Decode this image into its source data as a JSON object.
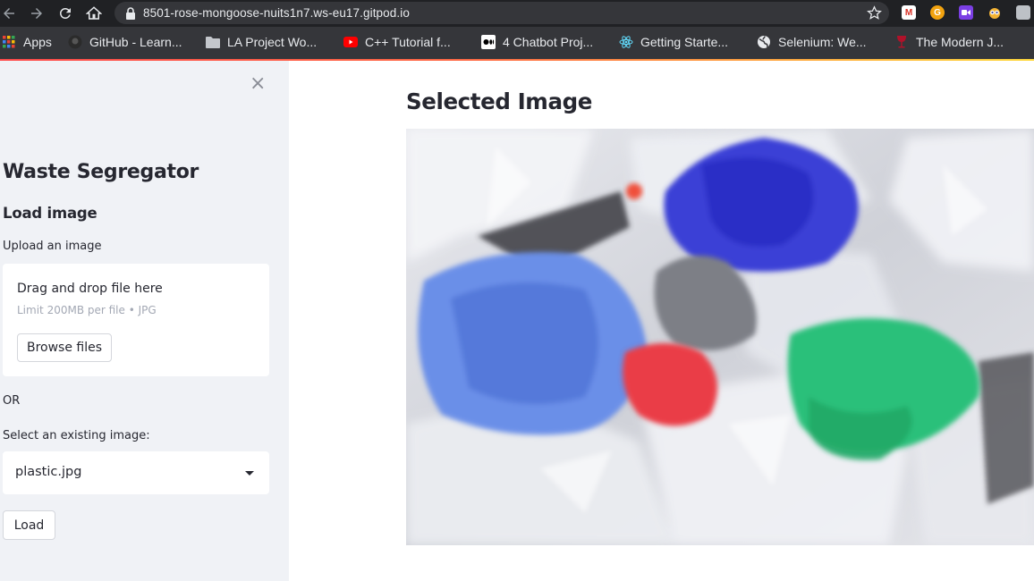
{
  "browser": {
    "url": "8501-rose-mongoose-nuits1n7.ws-eu17.gitpod.io",
    "bookmarks": [
      {
        "label": "Apps",
        "icon": "apps-grid-icon"
      },
      {
        "label": "GitHub - Learn...",
        "icon": "github-icon"
      },
      {
        "label": "LA Project Wo...",
        "icon": "folder-icon"
      },
      {
        "label": "C++ Tutorial f...",
        "icon": "youtube-icon"
      },
      {
        "label": "4 Chatbot Proj...",
        "icon": "medium-icon"
      },
      {
        "label": "Getting Starte...",
        "icon": "react-icon"
      },
      {
        "label": "Selenium: We...",
        "icon": "globe-icon"
      },
      {
        "label": "The Modern J...",
        "icon": "wine-glass-icon"
      }
    ],
    "extensions": [
      {
        "icon": "gmail-extension-icon",
        "glyph": "M",
        "color": "#d93025"
      },
      {
        "icon": "grammarly-extension-icon",
        "glyph": "G",
        "color": "#f2a30f"
      },
      {
        "icon": "video-extension-icon",
        "glyph": "",
        "color": "#7b3fe4"
      },
      {
        "icon": "owl-extension-icon",
        "glyph": "",
        "color": "#4a6bd6"
      },
      {
        "icon": "extensions-puzzle-icon",
        "glyph": "",
        "color": "#bdc1c6"
      }
    ]
  },
  "sidebar": {
    "close_glyph": "×",
    "title": "Waste Segregator",
    "section_heading": "Load image",
    "upload_label": "Upload an image",
    "uploader": {
      "main_text": "Drag and drop file here",
      "sub_text": "Limit 200MB per file • JPG",
      "browse_label": "Browse files"
    },
    "or_text": "OR",
    "select_label": "Select an existing image:",
    "select_value": "plastic.jpg",
    "load_label": "Load"
  },
  "main": {
    "heading": "Selected Image",
    "image_subject": "pile of plastic bags"
  },
  "colors": {
    "sidebar_bg": "#f0f2f6",
    "text": "#262730",
    "accent_gradient_start": "#ff4b4b",
    "accent_gradient_end": "#ffd93d"
  }
}
